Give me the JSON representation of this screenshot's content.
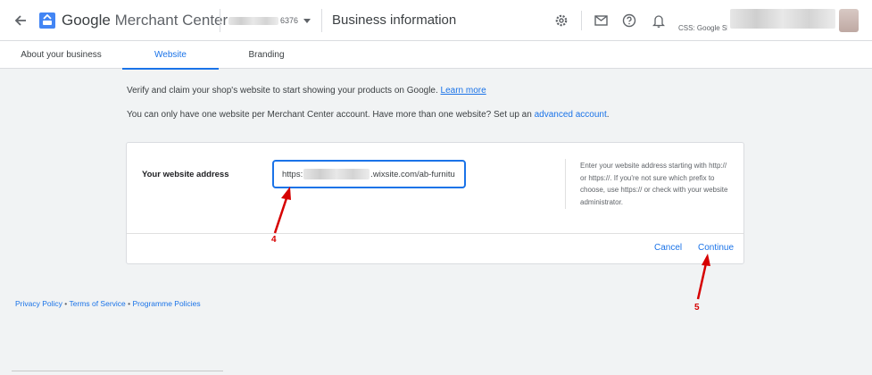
{
  "header": {
    "app_name_brand": "Google",
    "app_name_rest": "Merchant Center",
    "account_id_suffix": "6376",
    "page_title": "Business information",
    "css_label": "CSS: Google Sh"
  },
  "tabs": [
    {
      "label": "About your business",
      "active": false
    },
    {
      "label": "Website",
      "active": true
    },
    {
      "label": "Branding",
      "active": false
    }
  ],
  "intro": {
    "text": "Verify and claim your shop's website to start showing your products on Google.",
    "learn_more": "Learn more",
    "limit_text": "You can only have one website per Merchant Center account. Have more than one website? Set up an",
    "advanced_link": "advanced account",
    "period": "."
  },
  "form": {
    "field_label": "Your website address",
    "url_prefix": "https:",
    "url_suffix": ".wixsite.com/ab-furnitu",
    "help_text": "Enter your website address starting with http:// or https://. If you're not sure which prefix to choose, use https:// or check with your website administrator.",
    "cancel_label": "Cancel",
    "continue_label": "Continue"
  },
  "footer": {
    "privacy": "Privacy Policy",
    "terms": "Terms of Service",
    "programme": "Programme Policies",
    "sep": "•"
  },
  "annotations": {
    "step_4": "4",
    "step_5": "5"
  },
  "colors": {
    "accent": "#1a73e8",
    "annotation": "#d60000"
  }
}
